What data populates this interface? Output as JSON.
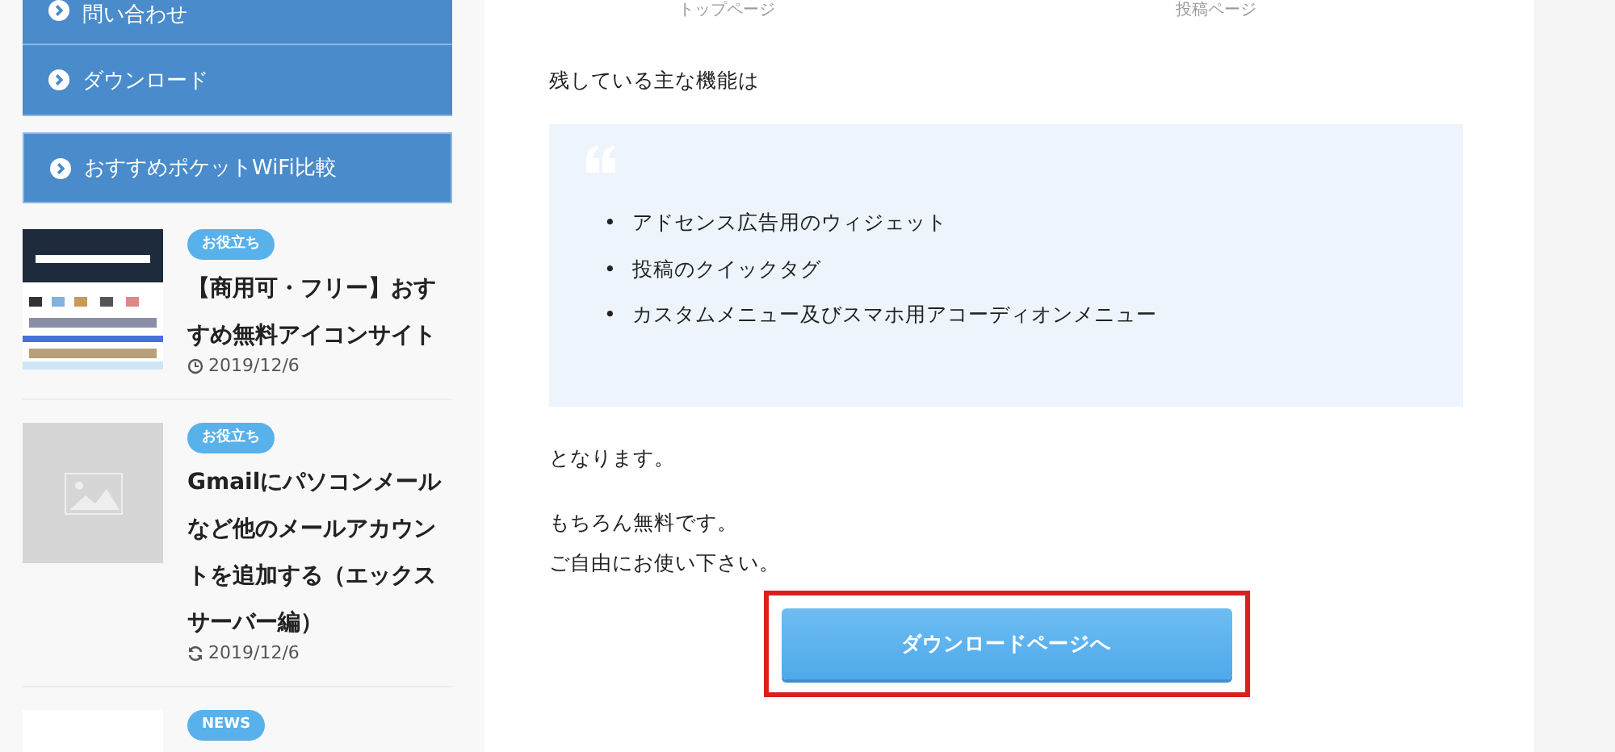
{
  "sidebar": {
    "menu": [
      {
        "label": "問い合わせ"
      },
      {
        "label": "ダウンロード"
      }
    ],
    "featured_menu": [
      {
        "label": "おすすめポケットWiFi比較"
      }
    ],
    "posts": [
      {
        "tag": "お役立ち",
        "title": "【商用可・フリー】おすすめ無料アイコンサイト",
        "date": {
          "kind": "clock",
          "text": "2019/12/6"
        }
      },
      {
        "thumb": {
          "kind": "placeholder"
        },
        "tag": "お役立ち",
        "title": "Gmailにパソコンメールなど他のメールアカウントを追加する（エックスサーバー編）",
        "date": {
          "kind": "refresh",
          "text": "2019/12/6"
        }
      },
      {
        "thumb": {
          "kind": "blank"
        },
        "tag": "NEWS"
      }
    ]
  },
  "article": {
    "captions": [
      "トップページ",
      "投稿ページ"
    ],
    "intro": "残している主な機能は",
    "quote": {
      "items": [
        {
          "bullet": "•",
          "text": "アドセンス広告用のウィジェット"
        },
        {
          "bullet": "•",
          "text": "投稿のクイックタグ"
        },
        {
          "bullet": "•",
          "text": "カスタムメニュー及びスマホ用アコーディオンメニュー"
        }
      ]
    },
    "paragraphs": [
      [
        "となります。"
      ],
      [
        "もちろん無料です。",
        "ご自由にお使い下さい。"
      ]
    ],
    "button": {
      "label": "ダウンロードページへ",
      "highlighted": true
    }
  }
}
